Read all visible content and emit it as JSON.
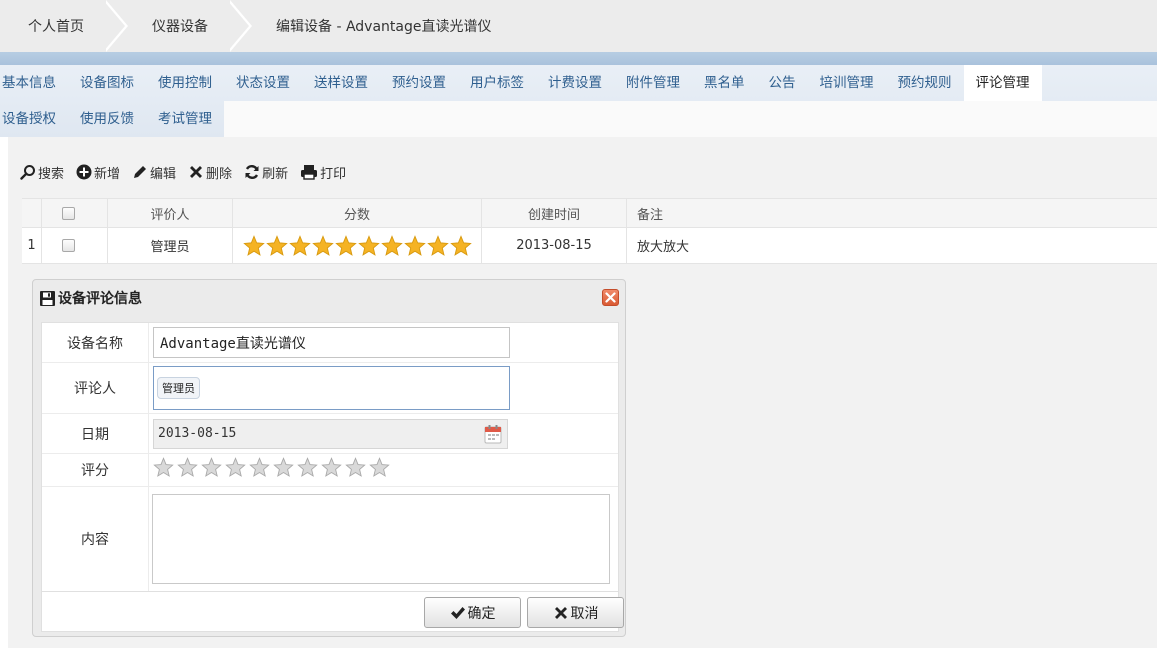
{
  "breadcrumb": {
    "home": "个人首页",
    "devices": "仪器设备",
    "current": "编辑设备 - Advantage直读光谱仪"
  },
  "tabs": {
    "row1": [
      "基本信息",
      "设备图标",
      "使用控制",
      "状态设置",
      "送样设置",
      "预约设置",
      "用户标签",
      "计费设置",
      "附件管理",
      "黑名单",
      "公告",
      "培训管理",
      "预约规则",
      "评论管理"
    ],
    "row2": [
      "设备授权",
      "使用反馈",
      "考试管理"
    ],
    "active": "评论管理"
  },
  "toolbar": {
    "search": "搜索",
    "add": "新增",
    "edit": "编辑",
    "delete": "删除",
    "refresh": "刷新",
    "print": "打印"
  },
  "grid": {
    "columns": {
      "reviewer": "评价人",
      "score": "分数",
      "created": "创建时间",
      "note": "备注"
    },
    "rows": [
      {
        "num": "1",
        "reviewer": "管理员",
        "stars": 10,
        "created": "2013-08-15",
        "note": "放大放大"
      }
    ]
  },
  "dialog": {
    "title": "设备评论信息",
    "labels": {
      "device": "设备名称",
      "reviewer": "评论人",
      "date": "日期",
      "rating": "评分",
      "content": "内容"
    },
    "device_value": "Advantage直读光谱仪",
    "reviewer_tag": "管理员",
    "date_value": "2013-08-15",
    "rating_stars": 10,
    "rating_value": 0,
    "content_value": "",
    "ok": "确定",
    "cancel": "取消"
  },
  "colors": {
    "star_gold": "#f5b324",
    "star_empty": "#c8c8c8",
    "tab_text": "#2f5f8f",
    "close_red": "#d95a33"
  }
}
